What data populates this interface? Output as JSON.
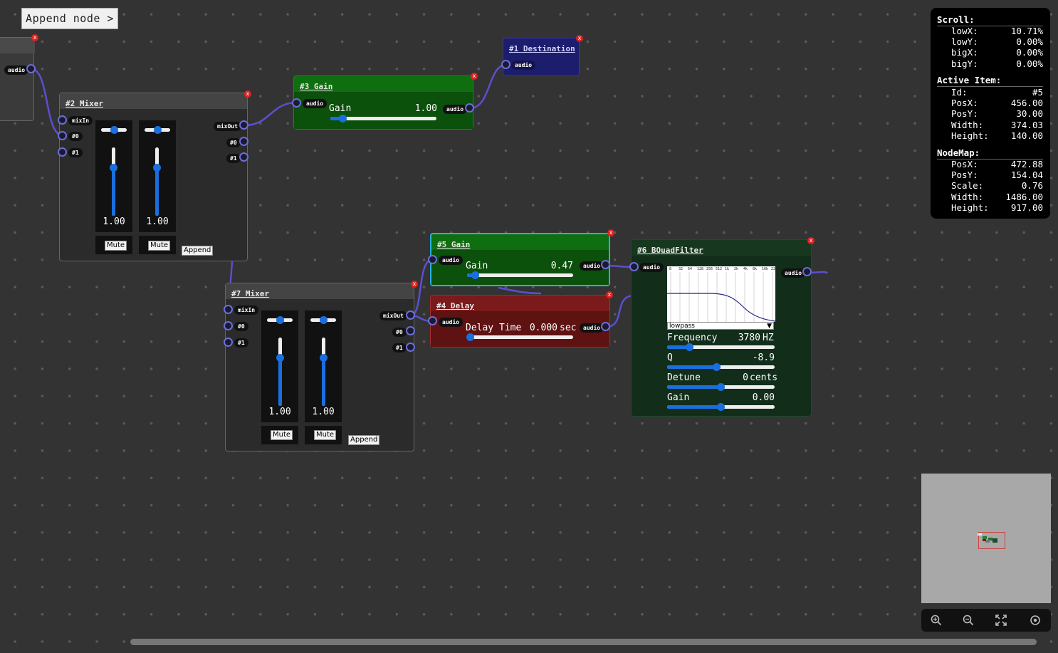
{
  "toolbar": {
    "append_label": "Append node  >"
  },
  "port_labels": {
    "audio": "audio",
    "mixIn": "mixIn",
    "mixOut": "mixOut",
    "in0": "#0",
    "in1": "#1"
  },
  "close_glyph": "x",
  "nodes": {
    "destination": {
      "title": "#1 Destination"
    },
    "mixer2": {
      "title": "#2 Mixer",
      "ch0_value": "1.00",
      "ch1_value": "1.00",
      "ch0_level": 1.0,
      "ch1_level": 1.0,
      "mute_label": "Mute",
      "append_label": "Append"
    },
    "gain3": {
      "title": "#3 Gain",
      "label": "Gain",
      "value": "1.00",
      "level": 1.0
    },
    "gain5": {
      "title": "#5 Gain",
      "label": "Gain",
      "value": "0.47",
      "level": 0.47
    },
    "delay4": {
      "title": "#4 Delay",
      "label": "Delay Time",
      "value": "0.000",
      "unit": "sec",
      "level": 0.0
    },
    "mixer7": {
      "title": "#7 Mixer",
      "ch0_value": "1.00",
      "ch1_value": "1.00",
      "ch0_level": 1.0,
      "ch1_level": 1.0,
      "mute_label": "Mute",
      "append_label": "Append"
    },
    "filter6": {
      "title": "#6 BQuadFilter",
      "freq_ticks": [
        "8",
        "32",
        "64",
        "128",
        "256",
        "512",
        "1k",
        "2k",
        "4k",
        "8k",
        "16k",
        "22k"
      ],
      "type_selected": "lowpass",
      "params": [
        {
          "label": "Frequency",
          "value": "3780",
          "unit": "HZ"
        },
        {
          "label": "Q",
          "value": "-8.9",
          "unit": ""
        },
        {
          "label": "Detune",
          "value": "0",
          "unit": "cents"
        },
        {
          "label": "Gain",
          "value": "0.00",
          "unit": ""
        }
      ]
    }
  },
  "info": {
    "scroll": {
      "heading": "Scroll:",
      "rows": [
        {
          "k": "lowX:",
          "v": "10.71%"
        },
        {
          "k": "lowY:",
          "v": "0.00%"
        },
        {
          "k": "bigX:",
          "v": "0.00%"
        },
        {
          "k": "bigY:",
          "v": "0.00%"
        }
      ]
    },
    "active": {
      "heading": "Active Item:",
      "rows": [
        {
          "k": "Id:",
          "v": "#5"
        },
        {
          "k": "PosX:",
          "v": "456.00"
        },
        {
          "k": "PosY:",
          "v": "30.00"
        },
        {
          "k": "Width:",
          "v": "374.03"
        },
        {
          "k": "Height:",
          "v": "140.00"
        }
      ]
    },
    "nodemap": {
      "heading": "NodeMap:",
      "rows": [
        {
          "k": "PosX:",
          "v": "472.88"
        },
        {
          "k": "PosY:",
          "v": "154.04"
        },
        {
          "k": "Scale:",
          "v": "0.76"
        },
        {
          "k": "Width:",
          "v": "1486.00"
        },
        {
          "k": "Height:",
          "v": "917.00"
        }
      ]
    }
  },
  "zoom_controls": [
    "zoom-in-icon",
    "zoom-out-icon",
    "fit-screen-icon",
    "center-icon"
  ],
  "colors": {
    "background": "#333333",
    "wire": "#5b4fd0",
    "port": "#6d6ed8",
    "gain_node": "#0f6e0f",
    "delay_node": "#7a1a1a",
    "destination_node": "#1d1d6e",
    "filter_node": "#163a22",
    "slider_accent": "#1a6fe0"
  }
}
